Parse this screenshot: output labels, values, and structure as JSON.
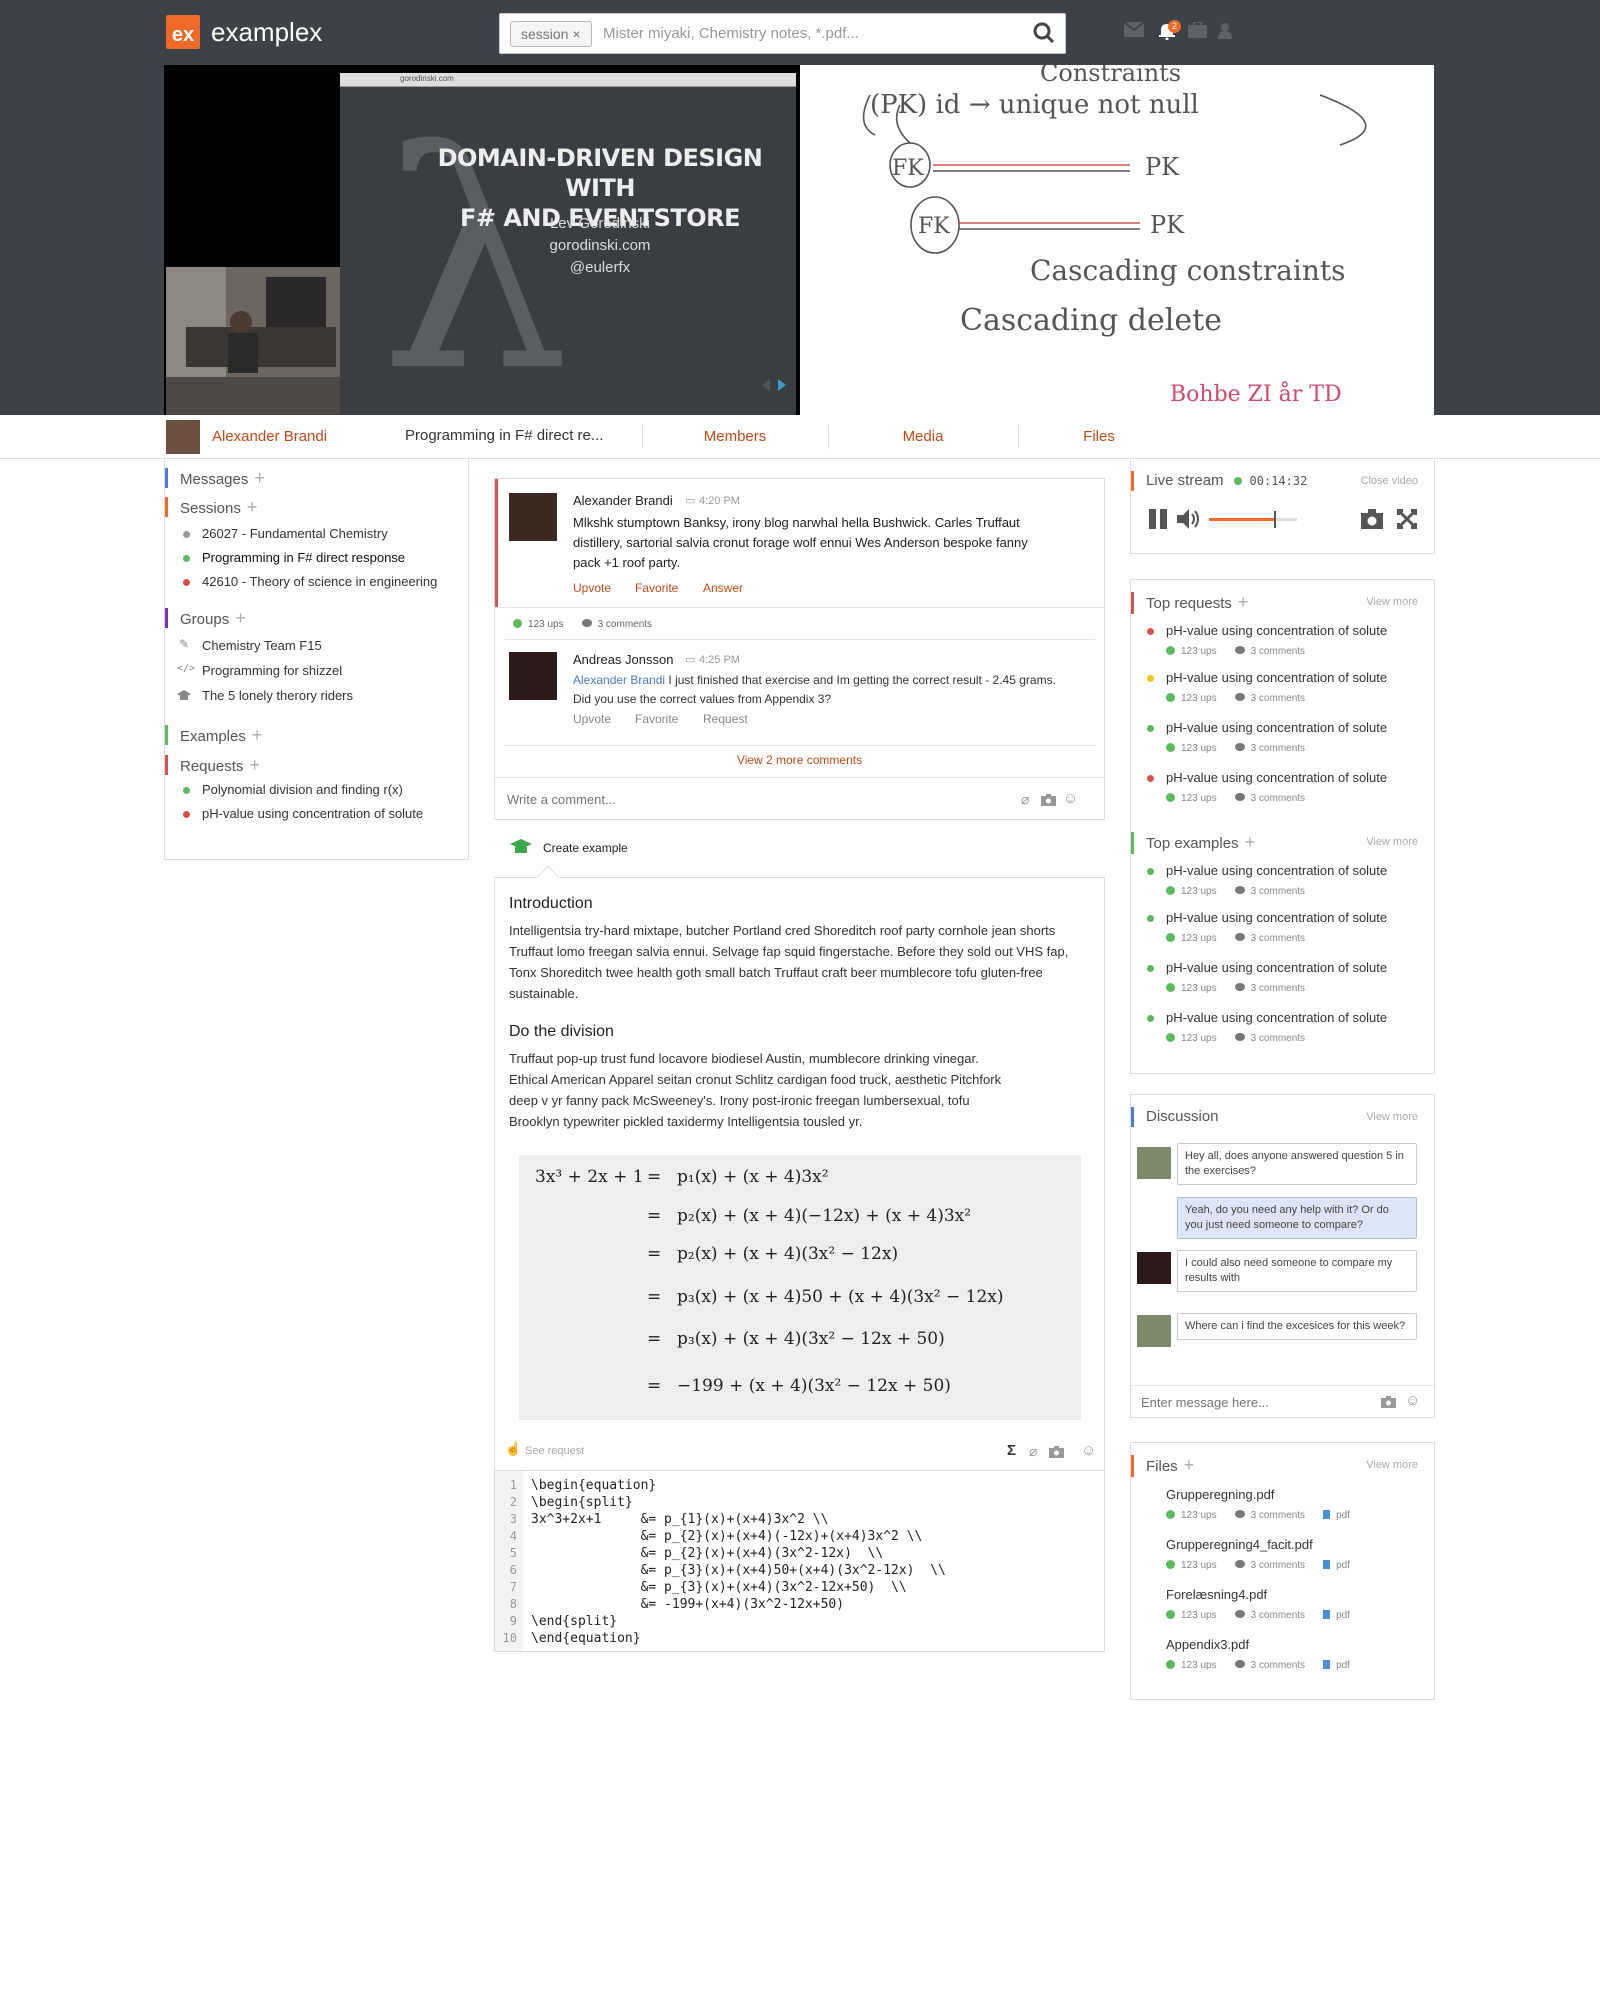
{
  "app": {
    "logo_mark": "ex",
    "name": "examplex",
    "accent": "#ef6a26"
  },
  "search": {
    "chip": "session ×",
    "placeholder": "Mister miyaki, Chemistry notes, *.pdf..."
  },
  "topbar": {
    "notification_count": "2",
    "icons": [
      "mail-icon",
      "bell-icon",
      "briefcase-icon",
      "user-icon"
    ]
  },
  "slide": {
    "title_line1": "DOMAIN-DRIVEN DESIGN WITH",
    "title_line2": "F# AND EVENTSTORE",
    "author": "Lev Gorodinski",
    "site": "gorodinski.com",
    "handle": "@eulerfx",
    "url": "gorodinski.com"
  },
  "whiteboard": {
    "lines": [
      "Constraints",
      "(PK) id → unique not null",
      "FK",
      "PK",
      "FK",
      "PK",
      "Cascading constraints",
      "Cascading delete",
      "Bohbe ZI år TD"
    ]
  },
  "tabbar": {
    "user": "Alexander Brandi",
    "session": "Programming in F# direct re...",
    "tabs": [
      "Members",
      "Media",
      "Files"
    ]
  },
  "sidebar": {
    "messages": "Messages",
    "sessions": "Sessions",
    "session_items": [
      {
        "label": "26027 - Fundamental Chemistry",
        "color": "#999999"
      },
      {
        "label": "Programming in F# direct response",
        "color": "#5cb85c"
      },
      {
        "label": "42610 - Theory of science in engineering",
        "color": "#d9534f"
      }
    ],
    "groups": "Groups",
    "group_items": [
      {
        "label": "Chemistry Team F15",
        "icon": "pencil-icon"
      },
      {
        "label": "Programming for shizzel",
        "icon": "code-icon"
      },
      {
        "label": "The 5 lonely therory riders",
        "icon": "graduation-cap-icon"
      }
    ],
    "examples": "Examples",
    "requests": "Requests",
    "request_items": [
      {
        "label": "Polynomial division and finding r(x)",
        "color": "#5cb85c"
      },
      {
        "label": "pH-value using concentration of solute",
        "color": "#d9534f"
      }
    ]
  },
  "post": {
    "author": "Alexander Brandi",
    "time": "4:20 PM",
    "body": "Mlkshk stumptown Banksy, irony blog narwhal hella Bushwick. Carles Truffaut distillery, sartorial salvia cronut forage wolf ennui Wes Anderson bespoke fanny pack +1 roof party.",
    "actions": [
      "Upvote",
      "Favorite",
      "Answer"
    ],
    "ups": "123 ups",
    "comments": "3 comments",
    "reply": {
      "author": "Andreas Jonsson",
      "time": "4:25 PM",
      "mention": "Alexander Brandi",
      "body": " I just finished that exercise and Im getting the correct result - 2.45 grams. Did you use the correct values from Appendix 3?",
      "actions": [
        "Upvote",
        "Favorite",
        "Request"
      ]
    },
    "view_more": "View 2 more comments",
    "comment_placeholder": "Write a comment..."
  },
  "create_example": "Create example",
  "example": {
    "h1": "Introduction",
    "p1": "Intelligentsia try-hard mixtape, butcher Portland cred Shoreditch roof party cornhole jean shorts Truffaut lomo freegan salvia ennui. Selvage fap squid fingerstache. Before they sold out VHS fap, Tonx Shoreditch twee health goth small batch Truffaut craft beer mumblecore tofu gluten-free sustainable.",
    "h2": "Do the division",
    "p2": "Truffaut pop-up trust fund locavore biodiesel Austin, mumblecore drinking vinegar. Ethical American Apparel seitan cronut Schlitz cardigan food truck, aesthetic Pitchfork deep v yr fanny pack McSweeney's. Irony post-ironic freegan lumbersexual, tofu Brooklyn typewriter pickled taxidermy Intelligentsia tousled yr.",
    "math_lhs": "3x³ + 2x + 1",
    "math_rows": [
      "p₁(x) + (x + 4)3x²",
      "p₂(x) + (x + 4)(−12x) + (x + 4)3x²",
      "p₂(x) + (x + 4)(3x² − 12x)",
      "p₃(x) + (x + 4)50 + (x + 4)(3x² − 12x)",
      "p₃(x) + (x + 4)(3x² − 12x + 50)",
      "−199 + (x + 4)(3x² − 12x + 50)"
    ],
    "see_request": "See request",
    "code_lines": [
      "\\begin{equation}",
      "\\begin{split}",
      "3x^3+2x+1     &= p_{1}(x)+(x+4)3x^2 \\\\",
      "              &= p_{2}(x)+(x+4)(-12x)+(x+4)3x^2 \\\\",
      "              &= p_{2}(x)+(x+4)(3x^2-12x)  \\\\",
      "              &= p_{3}(x)+(x+4)50+(x+4)(3x^2-12x)  \\\\",
      "              &= p_{3}(x)+(x+4)(3x^2-12x+50)  \\\\",
      "              &= -199+(x+4)(3x^2-12x+50)",
      "\\end{split}",
      "\\end{equation}"
    ],
    "line_numbers": [
      "1",
      "2",
      "3",
      "4",
      "5",
      "6",
      "7",
      "8",
      "9",
      "10"
    ]
  },
  "live": {
    "title": "Live stream",
    "timer": "00:14:32",
    "close": "Close video",
    "volume_level": 0.75
  },
  "top_requests": {
    "title": "Top requests",
    "view_more": "View more",
    "items": [
      {
        "label": "pH-value using concentration of solute",
        "color": "#d9534f",
        "ups": "123 ups",
        "comments": "3 comments"
      },
      {
        "label": "pH-value using concentration of solute",
        "color": "#f0c419",
        "ups": "123 ups",
        "comments": "3 comments"
      },
      {
        "label": "pH-value using concentration of solute",
        "color": "#5cb85c",
        "ups": "123 ups",
        "comments": "3 comments"
      },
      {
        "label": "pH-value using concentration of solute",
        "color": "#d9534f",
        "ups": "123 ups",
        "comments": "3 comments"
      }
    ]
  },
  "top_examples": {
    "title": "Top examples",
    "view_more": "View more",
    "items": [
      {
        "label": "pH-value using concentration of solute",
        "ups": "123 ups",
        "comments": "3 comments"
      },
      {
        "label": "pH-value using concentration of solute",
        "ups": "123 ups",
        "comments": "3 comments"
      },
      {
        "label": "pH-value using concentration of solute",
        "ups": "123 ups",
        "comments": "3 comments"
      },
      {
        "label": "pH-value using concentration of solute",
        "ups": "123 ups",
        "comments": "3 comments"
      }
    ]
  },
  "discussion": {
    "title": "Discussion",
    "view_more": "View more",
    "messages": [
      "Hey all, does anyone answered question 5 in the exercises?",
      "Yeah, do you need any help with it? Or do you just need someone to compare?",
      "I could also need someone to compare my results with",
      "Where can i find the excesices for this week?"
    ],
    "placeholder": "Enter message here..."
  },
  "files": {
    "title": "Files",
    "view_more": "View more",
    "items": [
      {
        "name": "Grupperegning.pdf",
        "ups": "123 ups",
        "comments": "3 comments",
        "type": "pdf"
      },
      {
        "name": "Grupperegning4_facit.pdf",
        "ups": "123 ups",
        "comments": "3 comments",
        "type": "pdf"
      },
      {
        "name": "Forelæsning4.pdf",
        "ups": "123 ups",
        "comments": "3 comments",
        "type": "pdf"
      },
      {
        "name": "Appendix3.pdf",
        "ups": "123 ups",
        "comments": "3 comments",
        "type": "pdf"
      }
    ]
  }
}
